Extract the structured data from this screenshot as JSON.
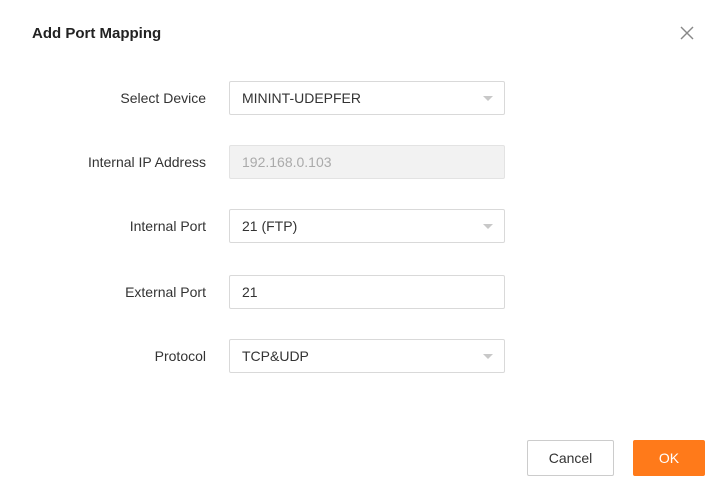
{
  "dialog": {
    "title": "Add Port Mapping",
    "close_icon": "close-icon"
  },
  "form": {
    "select_device": {
      "label": "Select Device",
      "value": "MININT-UDEPFER"
    },
    "internal_ip": {
      "label": "Internal IP Address",
      "value": "192.168.0.103"
    },
    "internal_port": {
      "label": "Internal Port",
      "value": "21 (FTP)"
    },
    "external_port": {
      "label": "External Port",
      "value": "21"
    },
    "protocol": {
      "label": "Protocol",
      "value": "TCP&UDP"
    }
  },
  "buttons": {
    "cancel_label": "Cancel",
    "ok_label": "OK"
  },
  "colors": {
    "accent": "#ff7a1a",
    "border": "#d9d9d9",
    "disabled_bg": "#f2f2f2"
  }
}
